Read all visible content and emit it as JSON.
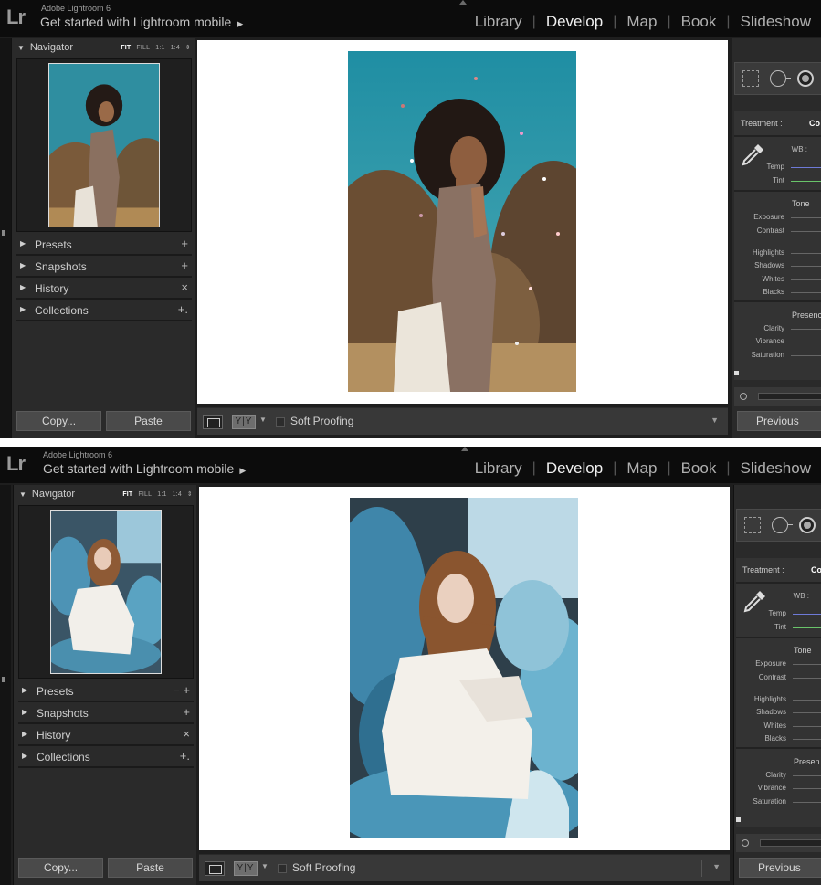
{
  "screens": [
    {
      "app_name": "Adobe Lightroom 6",
      "tagline": "Get started with Lightroom mobile",
      "modules": [
        "Library",
        "Develop",
        "Map",
        "Book",
        "Slideshow"
      ],
      "active_module": "Develop",
      "navigator": {
        "title": "Navigator",
        "zoom_options": [
          "FIT",
          "FILL",
          "1:1",
          "1:4"
        ]
      },
      "sections": [
        {
          "label": "Presets",
          "control": "+"
        },
        {
          "label": "Snapshots",
          "control": "+"
        },
        {
          "label": "History",
          "control": "×"
        },
        {
          "label": "Collections",
          "control": "+."
        }
      ],
      "buttons": {
        "copy": "Copy...",
        "paste": "Paste",
        "previous": "Previous"
      },
      "toolbar": {
        "yy": "Y|Y",
        "soft_proofing": "Soft Proofing"
      },
      "develop": {
        "treatment_label": "Treatment :",
        "treatment_value": "Co",
        "wb_label": "WB :",
        "tone_label": "Tone",
        "presence_label": "Presenc",
        "sliders": [
          "Temp",
          "Tint",
          "Exposure",
          "Contrast",
          "Highlights",
          "Shadows",
          "Whites",
          "Blacks",
          "Clarity",
          "Vibrance",
          "Saturation"
        ]
      },
      "photo": "curly-haired woman among flying petals, teal sky",
      "colors": {
        "accent_temp": "#6e7ad8",
        "accent_tint": "#69c46a"
      }
    },
    {
      "app_name": "Adobe Lightroom 6",
      "tagline": "Get started with Lightroom mobile",
      "modules": [
        "Library",
        "Develop",
        "Map",
        "Book",
        "Slideshow"
      ],
      "active_module": "Develop",
      "navigator": {
        "title": "Navigator",
        "zoom_options": [
          "FIT",
          "FILL",
          "1:1",
          "1:4"
        ]
      },
      "sections": [
        {
          "label": "Presets",
          "control": "− +"
        },
        {
          "label": "Snapshots",
          "control": "+"
        },
        {
          "label": "History",
          "control": "×"
        },
        {
          "label": "Collections",
          "control": "+."
        }
      ],
      "buttons": {
        "copy": "Copy...",
        "paste": "Paste",
        "previous": "Previous"
      },
      "toolbar": {
        "yy": "Y|Y",
        "soft_proofing": "Soft Proofing"
      },
      "develop": {
        "treatment_label": "Treatment :",
        "treatment_value": "Co",
        "wb_label": "WB :",
        "tone_label": "Tone",
        "presence_label": "Presen",
        "sliders": [
          "Temp",
          "Tint",
          "Exposure",
          "Contrast",
          "Highlights",
          "Shadows",
          "Whites",
          "Blacks",
          "Clarity",
          "Vibrance",
          "Saturation"
        ]
      },
      "photo": "woman in white seated among blue succulents",
      "colors": {
        "accent_temp": "#6e7ad8",
        "accent_tint": "#69c46a"
      }
    }
  ]
}
